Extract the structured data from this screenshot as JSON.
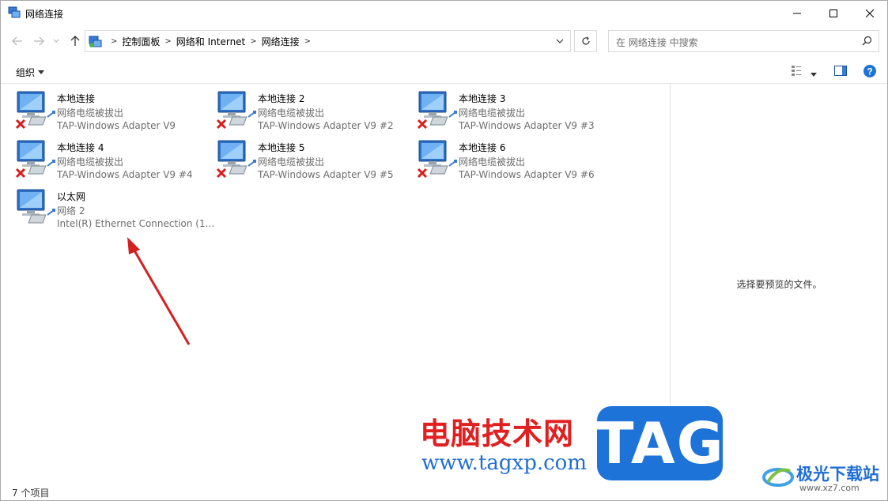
{
  "window": {
    "title": "网络连接",
    "min_icon": "minimize-icon",
    "max_icon": "maximize-icon",
    "close_icon": "close-icon"
  },
  "address": {
    "crumbs": [
      "控制面板",
      "网络和 Internet",
      "网络连接"
    ]
  },
  "search": {
    "placeholder": "在 网络连接 中搜索"
  },
  "toolbar": {
    "organize_label": "组织"
  },
  "connections": [
    {
      "name": "本地连接",
      "status": "网络电缆被拔出",
      "adapter": "TAP-Windows Adapter V9",
      "disconnected": true
    },
    {
      "name": "本地连接 2",
      "status": "网络电缆被拔出",
      "adapter": "TAP-Windows Adapter V9 #2",
      "disconnected": true
    },
    {
      "name": "本地连接 3",
      "status": "网络电缆被拔出",
      "adapter": "TAP-Windows Adapter V9 #3",
      "disconnected": true
    },
    {
      "name": "本地连接 4",
      "status": "网络电缆被拔出",
      "adapter": "TAP-Windows Adapter V9 #4",
      "disconnected": true
    },
    {
      "name": "本地连接 5",
      "status": "网络电缆被拔出",
      "adapter": "TAP-Windows Adapter V9 #5",
      "disconnected": true
    },
    {
      "name": "本地连接 6",
      "status": "网络电缆被拔出",
      "adapter": "TAP-Windows Adapter V9 #6",
      "disconnected": true
    },
    {
      "name": "以太网",
      "status": "网络 2",
      "adapter": "Intel(R) Ethernet Connection (1...",
      "disconnected": false
    }
  ],
  "preview": {
    "empty_text": "选择要预览的文件。"
  },
  "statusbar": {
    "count": "7 个项目"
  },
  "watermark": {
    "cn_text": "电脑技术网",
    "url": "www.tagxp.com",
    "tag": "TAG",
    "brand": "极光下载站",
    "brand_url": "www.xz7.com"
  },
  "colors": {
    "accent": "#1e73d8",
    "arrow": "#d42020",
    "error_x": "#d81e1e"
  }
}
